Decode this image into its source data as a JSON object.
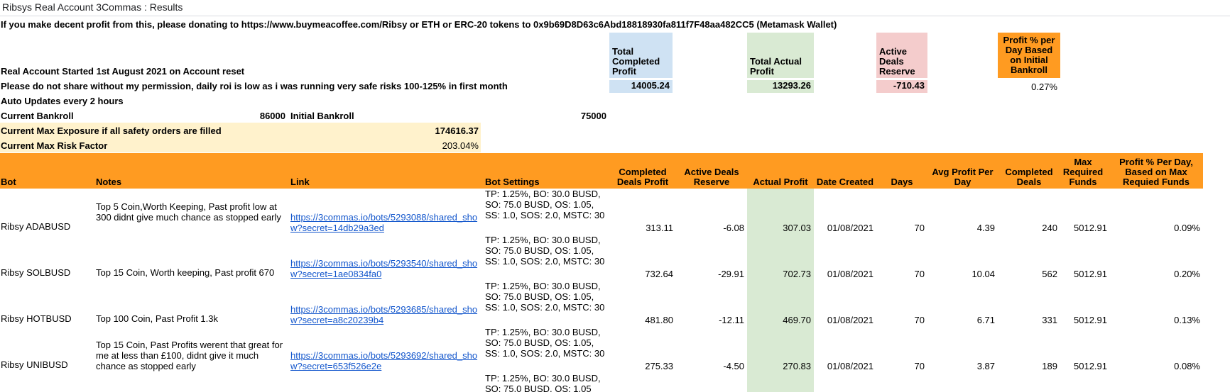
{
  "title": "Ribsys Real Account 3Commas : Results",
  "donation_text": "If you make decent profit from this, please donating to https://www.buymeacoffee.com/Ribsy or ETH or ERC-20 tokens to 0x9b69D8D63c6Abd18818930fa811f7F48aa482CC5 (Metamask Wallet)",
  "account_started": "Real Account Started 1st August 2021 on Account reset",
  "permission_note": "Please do not share without my permission, daily roi is low as i was running very safe risks 100-125% in first month",
  "auto_updates": "Auto Updates every 2 hours",
  "current_bankroll": {
    "label": "Current Bankroll",
    "value": "86000"
  },
  "initial_bankroll": {
    "label": "Initial Bankroll",
    "value": "75000"
  },
  "max_exposure": {
    "label": "Current Max Exposure if all safety orders are filled",
    "value": "174616.37"
  },
  "max_risk": {
    "label": "Current Max Risk Factor",
    "value": "203.04%"
  },
  "summary": {
    "total_completed_profit": {
      "label": "Total Completed Profit",
      "value": "14005.24"
    },
    "total_actual_profit": {
      "label": "Total Actual Profit",
      "value": "13293.26"
    },
    "active_deals_reserve": {
      "label": "Active Deals Reserve",
      "value": "-710.43"
    },
    "profit_pct_per_day": {
      "label": "Profit % per Day Based on Initial Bankroll",
      "value": "0.27%"
    }
  },
  "columns": {
    "bot": "Bot",
    "notes": "Notes",
    "link": "Link",
    "bot_settings": "Bot Settings",
    "completed_deals_profit": "Completed Deals Profit",
    "active_deals_reserve": "Active Deals Reserve",
    "actual_profit": "Actual Profit",
    "date_created": "Date Created",
    "days": "Days",
    "avg_profit_per_day": "Avg Profit Per Day",
    "completed_deals": "Completed Deals",
    "max_required_funds": "Max Required Funds",
    "profit_pct_per_day": "Profit % Per Day, Based on Max Requied Funds"
  },
  "rows": [
    {
      "bot": "Ribsy ADABUSD",
      "notes": "Top 5 Coin,Worth Keeping, Past profit low at 300 didnt give much chance as stopped early",
      "link": "https://3commas.io/bots/5293088/shared_show?secret=14db29a3ed",
      "settings": "TP: 1.25%, BO: 30.0 BUSD, SO: 75.0 BUSD, OS: 1.05, SS: 1.0, SOS: 2.0, MSTC: 30",
      "completed_deals_profit": "313.11",
      "active_deals_reserve": "-6.08",
      "actual_profit": "307.03",
      "date_created": "01/08/2021",
      "days": "70",
      "avg_profit_per_day": "4.39",
      "completed_deals": "240",
      "max_required_funds": "5012.91",
      "profit_pct_per_day": "0.09%"
    },
    {
      "bot": "Ribsy SOLBUSD",
      "notes": "Top 15 Coin, Worth keeping, Past profit 670",
      "link": "https://3commas.io/bots/5293540/shared_show?secret=1ae0834fa0",
      "settings": "TP: 1.25%, BO: 30.0 BUSD, SO: 75.0 BUSD, OS: 1.05, SS: 1.0, SOS: 2.0, MSTC: 30",
      "completed_deals_profit": "732.64",
      "active_deals_reserve": "-29.91",
      "actual_profit": "702.73",
      "date_created": "01/08/2021",
      "days": "70",
      "avg_profit_per_day": "10.04",
      "completed_deals": "562",
      "max_required_funds": "5012.91",
      "profit_pct_per_day": "0.20%"
    },
    {
      "bot": "Ribsy HOTBUSD",
      "notes": "Top 100 Coin, Past Profit 1.3k",
      "link": "https://3commas.io/bots/5293685/shared_show?secret=a8c20239b4",
      "settings": "TP: 1.25%, BO: 30.0 BUSD, SO: 75.0 BUSD, OS: 1.05, SS: 1.0, SOS: 2.0, MSTC: 30",
      "completed_deals_profit": "481.80",
      "active_deals_reserve": "-12.11",
      "actual_profit": "469.70",
      "date_created": "01/08/2021",
      "days": "70",
      "avg_profit_per_day": "6.71",
      "completed_deals": "331",
      "max_required_funds": "5012.91",
      "profit_pct_per_day": "0.13%"
    },
    {
      "bot": "Ribsy UNIBUSD",
      "notes": "Top 15 Coin, Past Profits werent that great for me at less than £100, didnt give it much chance as stopped early",
      "link": "https://3commas.io/bots/5293692/shared_show?secret=653f526e2e",
      "settings": "TP: 1.25%, BO: 30.0 BUSD, SO: 75.0 BUSD, OS: 1.05, SS: 1.0, SOS: 2.0, MSTC: 30",
      "completed_deals_profit": "275.33",
      "active_deals_reserve": "-4.50",
      "actual_profit": "270.83",
      "date_created": "01/08/2021",
      "days": "70",
      "avg_profit_per_day": "3.87",
      "completed_deals": "189",
      "max_required_funds": "5012.91",
      "profit_pct_per_day": "0.08%"
    },
    {
      "bot": "",
      "notes": "",
      "link": "",
      "settings": "TP: 1.25%, BO: 30.0 BUSD, SO: 75.0 BUSD, OS: 1.05",
      "completed_deals_profit": "",
      "active_deals_reserve": "",
      "actual_profit": "",
      "date_created": "",
      "days": "",
      "avg_profit_per_day": "",
      "completed_deals": "",
      "max_required_funds": "",
      "profit_pct_per_day": ""
    }
  ],
  "colors": {
    "header_orange": "#ff9b21",
    "highlight_yellow": "#fff2cc",
    "profit_green": "#d9ead3",
    "completed_blue": "#cfe2f3",
    "reserve_red": "#f4cccc",
    "link_blue": "#1155cc"
  }
}
